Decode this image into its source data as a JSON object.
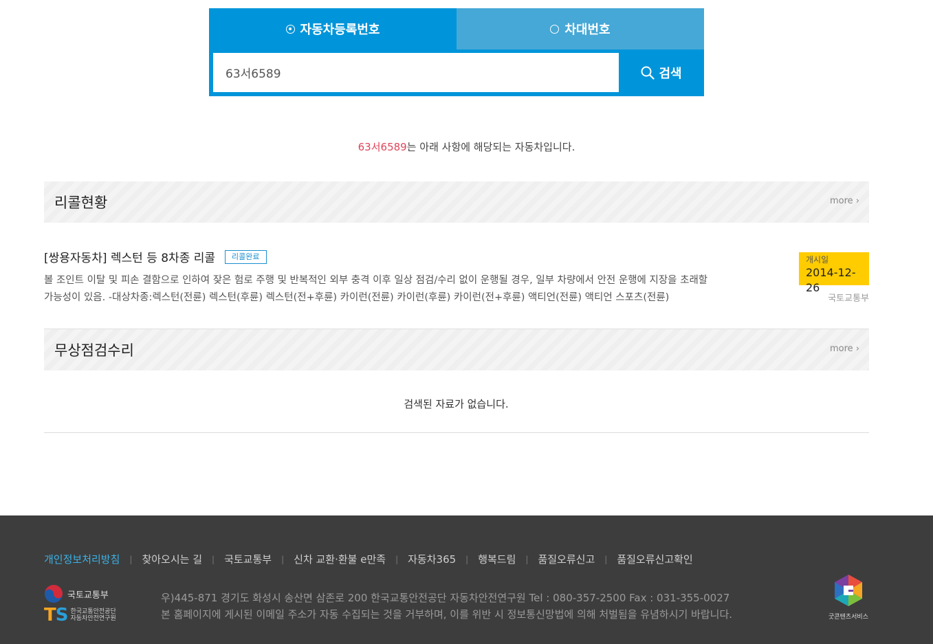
{
  "search": {
    "tabs": [
      {
        "label": "자동차등록번호",
        "selected": true
      },
      {
        "label": "차대번호",
        "selected": false
      }
    ],
    "input_value": "63서6589",
    "button_label": "검색",
    "button_icon": "search-icon"
  },
  "result": {
    "plate": "63서6589",
    "message_suffix": "는 아래 사항에 해당되는 자동차입니다."
  },
  "sections": {
    "recall": {
      "title": "리콜현황",
      "more": "more",
      "items": [
        {
          "title": "[쌍용자동차] 렉스턴 등 8차종 리콜",
          "badge": "리콜완료",
          "description_line1": "볼 조인트 이탈 및 피손 결함으로 인하여 잦은 험로 주행 및 반복적인 외부 충격 이후 일상 점검/수리 없이 운행될 경우, 일부 차량에서 안전 운행에 지장을 초래할",
          "description_line2": "가능성이 있음. -대상차종:렉스턴(전륜) 렉스턴(후륜) 렉스턴(전+후륜) 카이런(전륜) 카이런(후륜) 카이런(전+후륜) 액티언(전륜) 액티언 스포츠(전륜)",
          "date_label": "개시일",
          "date": "2014-12-26",
          "agency": "국토교통부"
        }
      ]
    },
    "free_inspection": {
      "title": "무상점검수리",
      "more": "more",
      "empty_message": "검색된 자료가 없습니다."
    }
  },
  "footer": {
    "links": [
      "개인정보처리방침",
      "찾아오시는 길",
      "국토교통부",
      "신차 교환·환불 e만족",
      "자동차365",
      "행복드림",
      "품질오류신고",
      "품질오류신고확인"
    ],
    "gov_logo_text": "국토교통부",
    "ts_logo_text": "TS",
    "ts_logo_sub1": "한국교통안전공단",
    "ts_logo_sub2": "자동차안전연구원",
    "address_line1": "우)445-871 경기도 화성시 송산면 삼존로 200 한국교통안전공단 자동차안전연구원 Tel : 080-357-2500 Fax : 031-355-0027",
    "address_line2": "본 홈페이지에 게시된 이메일 주소가 자동 수집되는 것을 거부하며, 이를 위반 시 정보통신망법에 의해 처벌됨을 유념하시기 바랍니다.",
    "goodcontent_text": "굿콘텐츠서비스"
  },
  "colors": {
    "accent": "#0095da",
    "tab_inactive": "#46a8d6",
    "plate_highlight": "#e0455a",
    "date_box": "#ffcc00",
    "footer_bg": "#3d3d3d",
    "footer_link_active": "#3cb2e6"
  }
}
